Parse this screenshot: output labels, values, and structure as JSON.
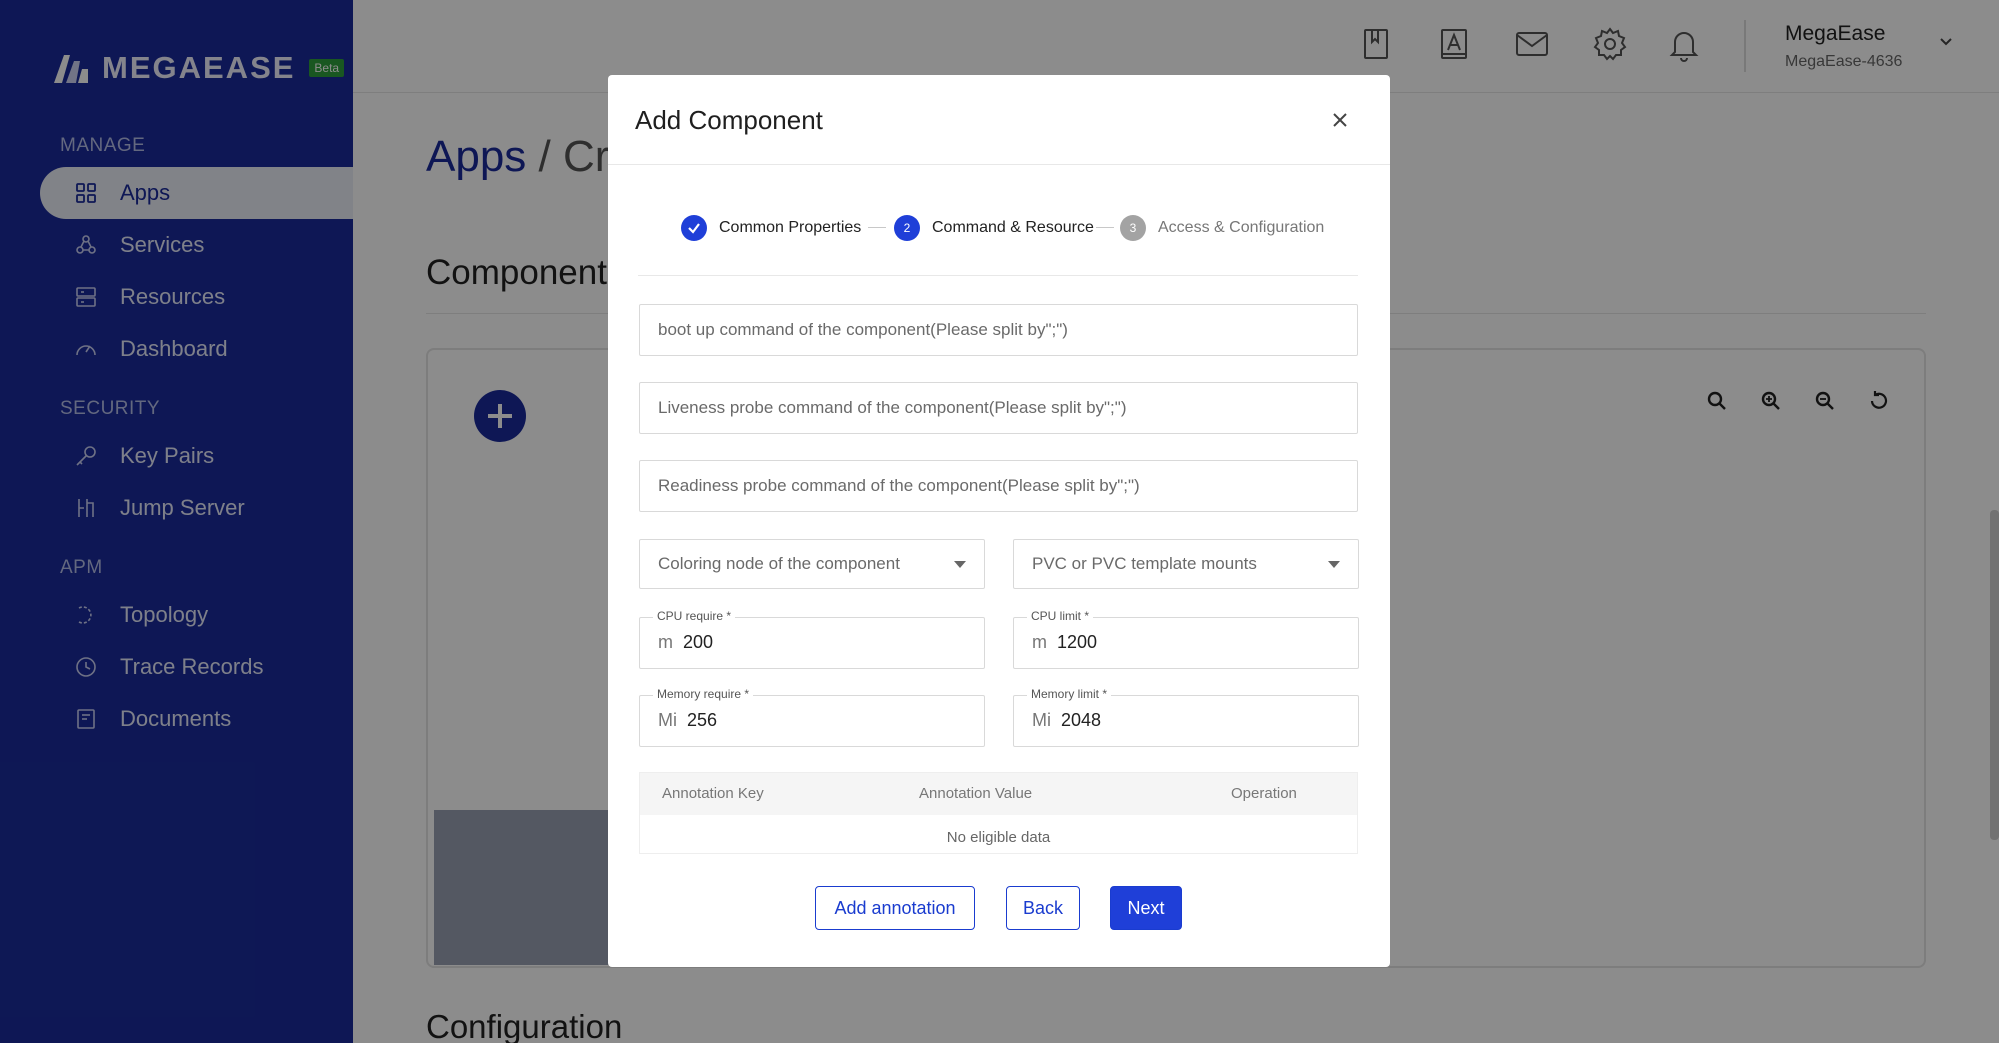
{
  "sidebar": {
    "brand": "MEGAEASE",
    "beta_badge": "Beta",
    "sections": {
      "manage": "MANAGE",
      "security": "SECURITY",
      "apm": "APM"
    },
    "items": [
      {
        "label": "Apps",
        "icon": "grid-icon",
        "active": true
      },
      {
        "label": "Services",
        "icon": "services-icon"
      },
      {
        "label": "Resources",
        "icon": "server-icon"
      },
      {
        "label": "Dashboard",
        "icon": "gauge-icon"
      },
      {
        "label": "Key Pairs",
        "icon": "key-icon"
      },
      {
        "label": "Jump Server",
        "icon": "jump-server-icon"
      },
      {
        "label": "Topology",
        "icon": "topology-icon"
      },
      {
        "label": "Trace Records",
        "icon": "clock-icon"
      },
      {
        "label": "Documents",
        "icon": "document-icon"
      }
    ]
  },
  "header": {
    "user_name": "MegaEase",
    "user_id": "MegaEase-4636"
  },
  "page": {
    "breadcrumb_apps": "Apps",
    "breadcrumb_sep": "/",
    "breadcrumb_current": "Cr",
    "components_title": "Components",
    "config_title": "Configuration"
  },
  "modal": {
    "title": "Add Component",
    "steps": [
      {
        "number": "✓",
        "label": "Common Properties",
        "state": "done"
      },
      {
        "number": "2",
        "label": "Command & Resource",
        "state": "active"
      },
      {
        "number": "3",
        "label": "Access & Configuration",
        "state": "pending"
      }
    ],
    "inputs": {
      "boot_cmd": "boot up command of the component(Please split by\";\")",
      "liveness_cmd": "Liveness probe command of the component(Please split by\";\")",
      "readiness_cmd": "Readiness probe command of the component(Please split by\";\")"
    },
    "selects": {
      "coloring_node": "Coloring node of the component",
      "pvc_mounts": "PVC or PVC template mounts"
    },
    "resources": {
      "cpu_require": {
        "label": "CPU require *",
        "unit": "m",
        "value": "200"
      },
      "cpu_limit": {
        "label": "CPU limit *",
        "unit": "m",
        "value": "1200"
      },
      "mem_require": {
        "label": "Memory require *",
        "unit": "Mi",
        "value": "256"
      },
      "mem_limit": {
        "label": "Memory limit *",
        "unit": "Mi",
        "value": "2048"
      }
    },
    "table": {
      "headers": [
        "Annotation Key",
        "Annotation Value",
        "Operation"
      ],
      "empty_text": "No eligible data"
    },
    "buttons": {
      "add_annotation": "Add annotation",
      "back": "Back",
      "next": "Next"
    }
  },
  "colors": {
    "brand": "#1a2b9b",
    "primary": "#1f3fd8"
  }
}
